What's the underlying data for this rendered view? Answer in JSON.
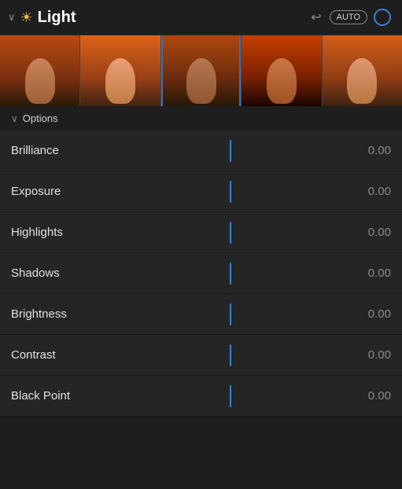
{
  "header": {
    "title": "Light",
    "auto_label": "AUTO",
    "undo_icon": "↩",
    "chevron": "∨"
  },
  "options": {
    "label": "Options",
    "chevron": "∨"
  },
  "sliders": [
    {
      "label": "Brilliance",
      "value": "0.00"
    },
    {
      "label": "Exposure",
      "value": "0.00"
    },
    {
      "label": "Highlights",
      "value": "0.00"
    },
    {
      "label": "Shadows",
      "value": "0.00"
    },
    {
      "label": "Brightness",
      "value": "0.00"
    },
    {
      "label": "Contrast",
      "value": "0.00"
    },
    {
      "label": "Black Point",
      "value": "0.00"
    }
  ],
  "colors": {
    "accent_blue": "#3a7fd5",
    "header_bg": "#1e1e1e",
    "row_bg": "#252525",
    "text_primary": "#e0e0e0",
    "text_secondary": "#8a8a8e"
  }
}
